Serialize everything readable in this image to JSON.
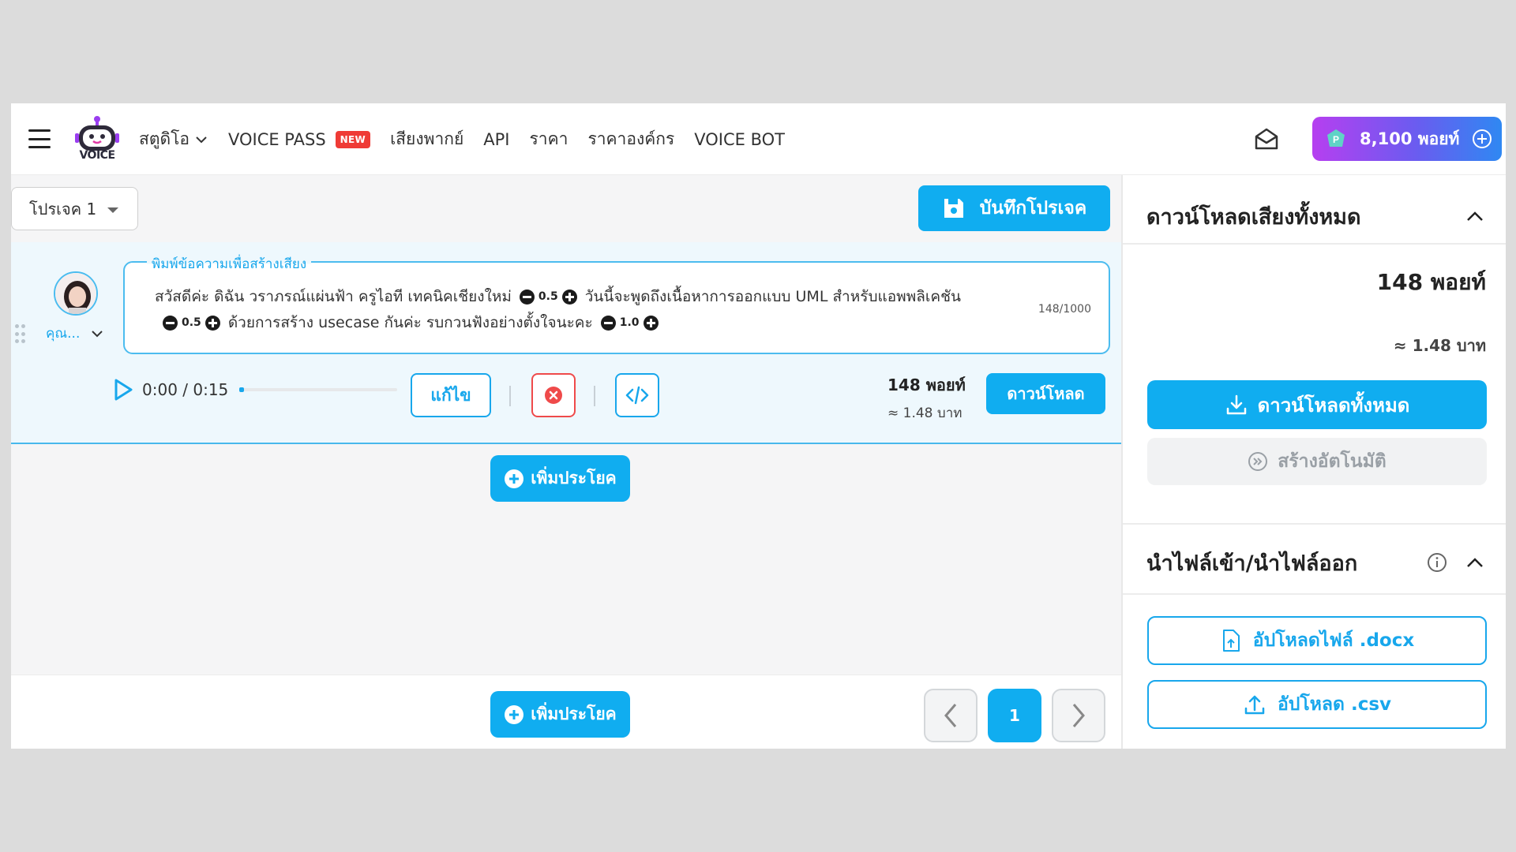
{
  "nav": {
    "logo_text": "VOICE",
    "items": [
      {
        "label": "สตูดิโอ",
        "has_dropdown": true
      },
      {
        "label": "VOICE PASS",
        "badge": "NEW"
      },
      {
        "label": "เสียงพากย์"
      },
      {
        "label": "API"
      },
      {
        "label": "ราคา"
      },
      {
        "label": "ราคาองค์กร"
      },
      {
        "label": "VOICE BOT"
      }
    ],
    "points_label": "8,100 พอยท์",
    "accent_gradient": [
      "#b63ff0",
      "#6a5cf0",
      "#2f88f2"
    ]
  },
  "project": {
    "selected": "โปรเจค 1",
    "save_label": "บันทึกโปรเจค"
  },
  "sentence": {
    "voice_name": "คุณ...",
    "legend": "พิมพ์ข้อความเพื่อสร้างเสียง",
    "segments_line1": {
      "t1": "สวัสดีค่ะ ดิฉัน วราภรณ์แผ่นฟ้า ครูไอที เทคนิคเชียงใหม่",
      "pause1": "0.5",
      "t2": "วันนี้จะพูดถึงเนื้อหาการออกแบบ UML สำหรับแอพพลิเคชัน"
    },
    "segments_line2": {
      "pause2": "0.5",
      "t3": "ด้วยการสร้าง usecase  กันค่ะ รบกวนฟังอย่างตั้งใจนะคะ",
      "pause3": "1.0"
    },
    "char_count": "148/1000",
    "time": "0:00 / 0:15",
    "progress_fraction": 0.02,
    "edit_label": "แก้ไข",
    "points": "148 พอยท์",
    "baht": "≈ 1.48 บาท",
    "download_label": "ดาวน์โหลด"
  },
  "add_sentence_label": "เพิ่มประโยค",
  "pagination": {
    "current": "1"
  },
  "download_panel": {
    "title": "ดาวน์โหลดเสียงทั้งหมด",
    "total_points": "148 พอยท์",
    "total_baht": "≈ 1.48 บาท",
    "download_all_label": "ดาวน์โหลดทั้งหมด",
    "auto_label": "สร้างอัตโนมัติ"
  },
  "import_panel": {
    "title": "นำไฟล์เข้า/นำไฟล์ออก",
    "upload_docx_label": "อัปโหลดไฟล์ .docx",
    "upload_csv_label": "อัปโหลด .csv"
  },
  "colors": {
    "primary": "#10adf0",
    "danger": "#ef4a4a"
  }
}
